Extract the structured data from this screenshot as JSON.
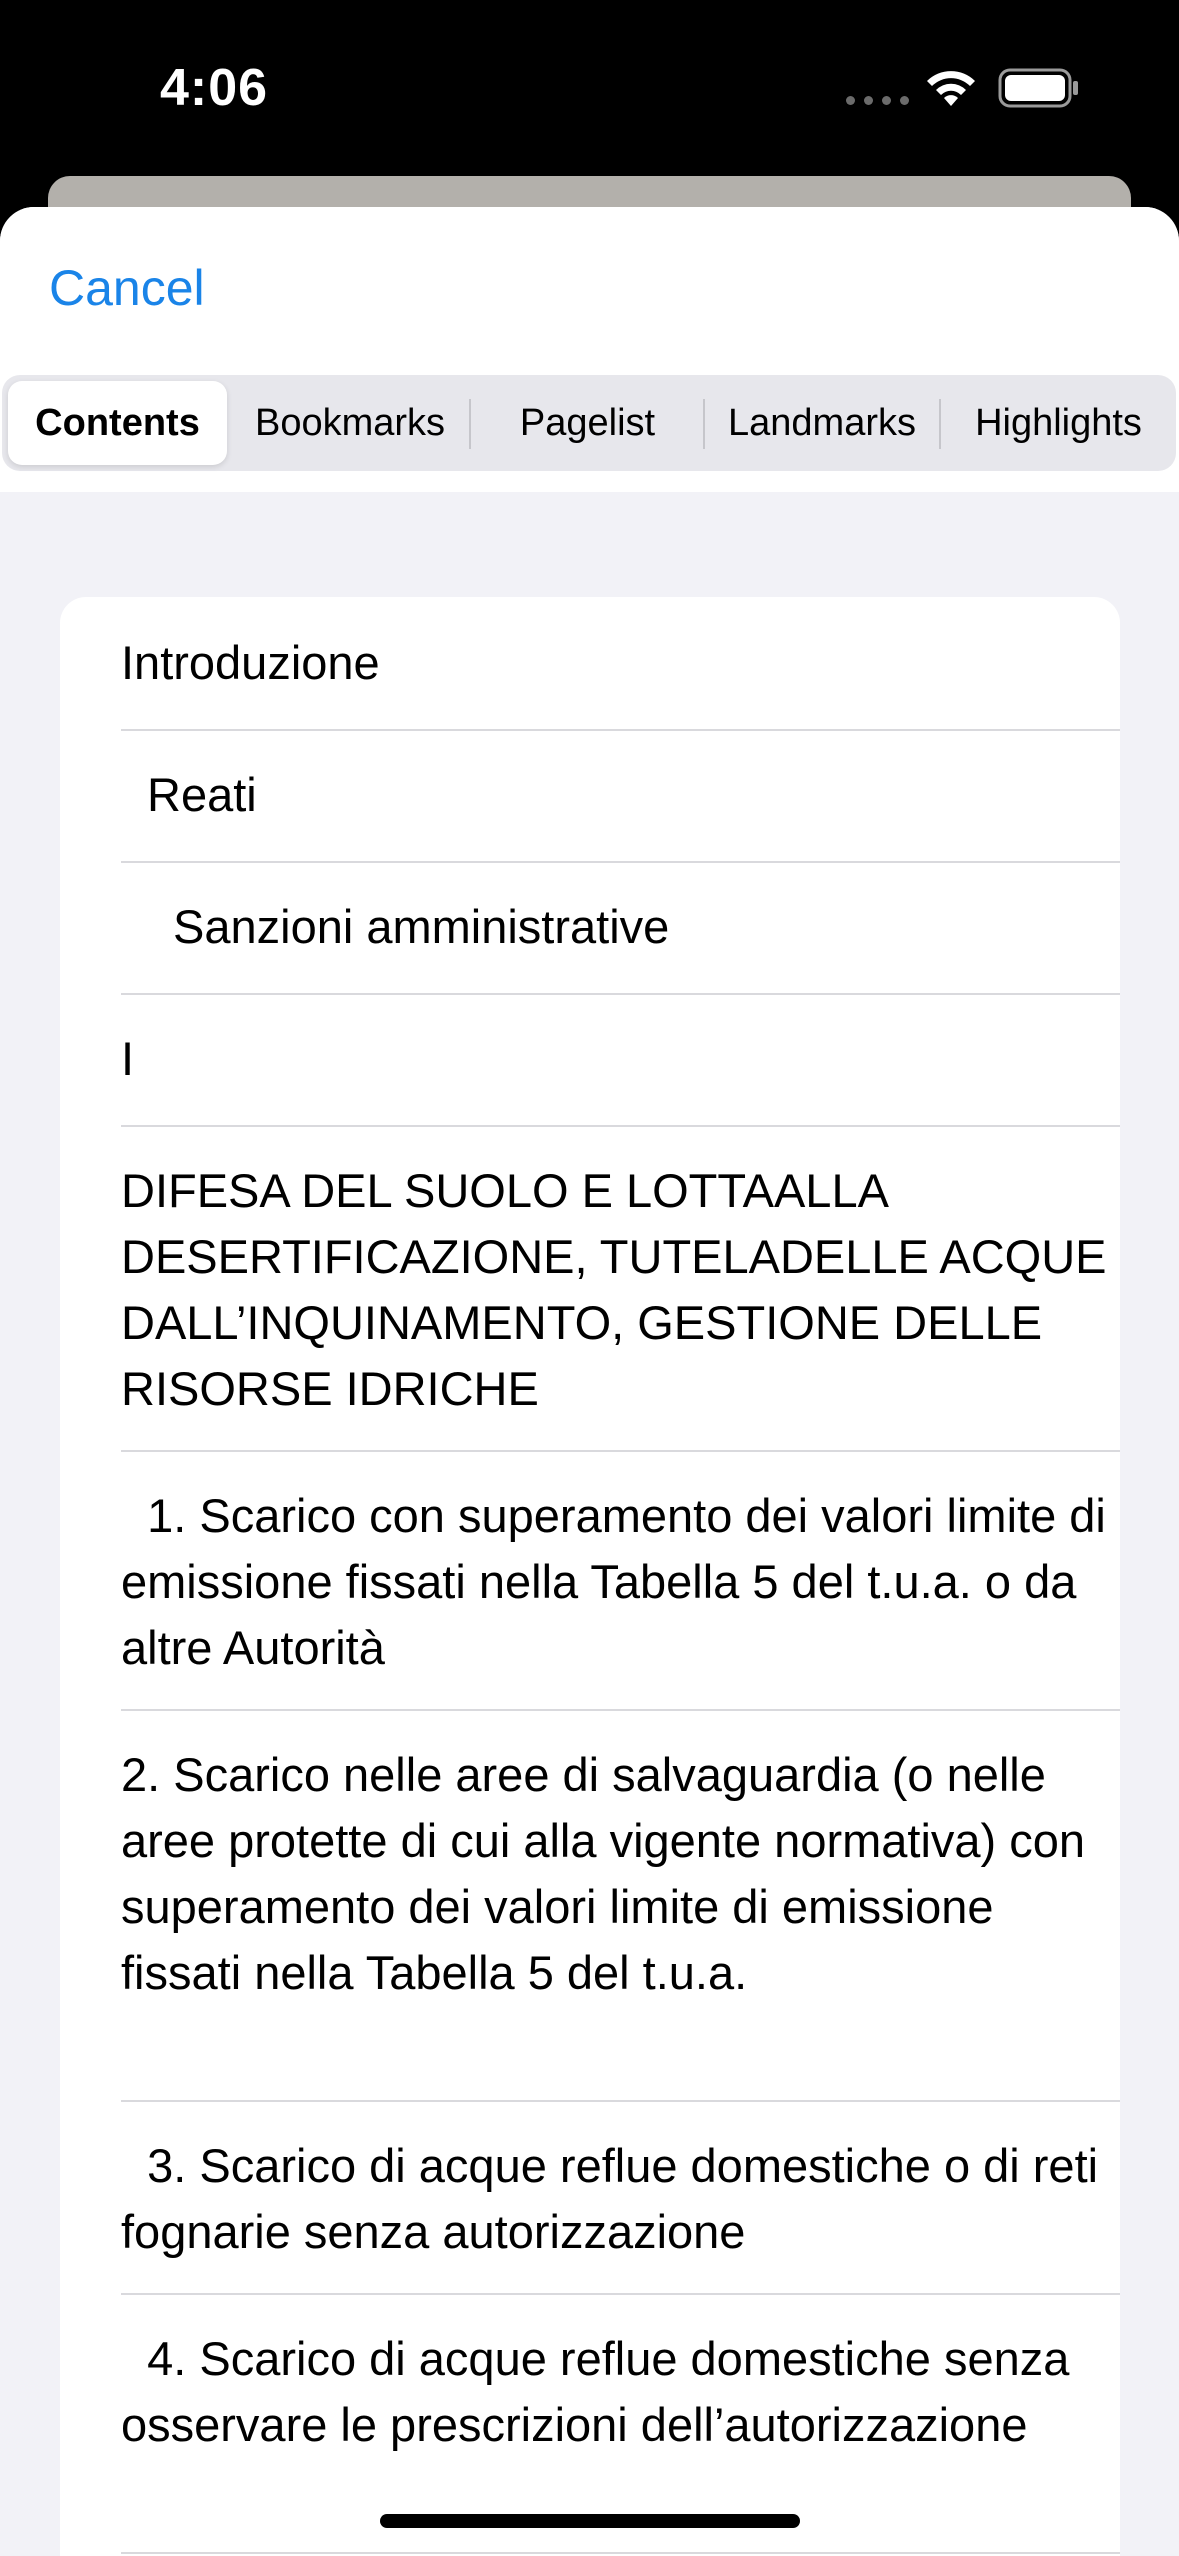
{
  "status": {
    "time": "4:06"
  },
  "header": {
    "cancel_label": "Cancel"
  },
  "tabs": [
    {
      "label": "Contents",
      "selected": true
    },
    {
      "label": "Bookmarks",
      "selected": false
    },
    {
      "label": "Pagelist",
      "selected": false
    },
    {
      "label": "Landmarks",
      "selected": false
    },
    {
      "label": "Highlights",
      "selected": false
    }
  ],
  "contents": [
    {
      "text": "Introduzione",
      "level": 0
    },
    {
      "text": "Reati",
      "level": 1
    },
    {
      "text": "Sanzioni amministrative",
      "level": 2
    },
    {
      "text": "I",
      "level": 0
    },
    {
      "text": "DIFESA DEL SUOLO E LOTTAALLA DESERTIFICAZIONE, TUTELADELLE ACQUE DALL’INQUINAMENTO, GESTIONE DELLE RISORSE IDRICHE",
      "level": 0
    },
    {
      "text": "  1. Scarico con superamento dei valori limite di emissione fissati nella Tabella 5 del t.u.a. o da altre Autorità",
      "level": 0
    },
    {
      "text": "2. Scarico nelle aree di salvaguardia (o nelle aree protette di cui alla vigente normativa) con superamento dei valori limite di emissione fissati nella Tabella 5 del t.u.a.",
      "level": 0
    },
    {
      "text": "  3. Scarico di acque reflue domestiche o di reti fognarie senza autorizzazione",
      "level": 0
    },
    {
      "text": "  4. Scarico di acque reflue domestiche senza osservare le prescrizioni dell’autorizzazione",
      "level": 0
    }
  ],
  "colors": {
    "accent": "#1a84e8",
    "sheet_background": "#f2f2f7"
  }
}
